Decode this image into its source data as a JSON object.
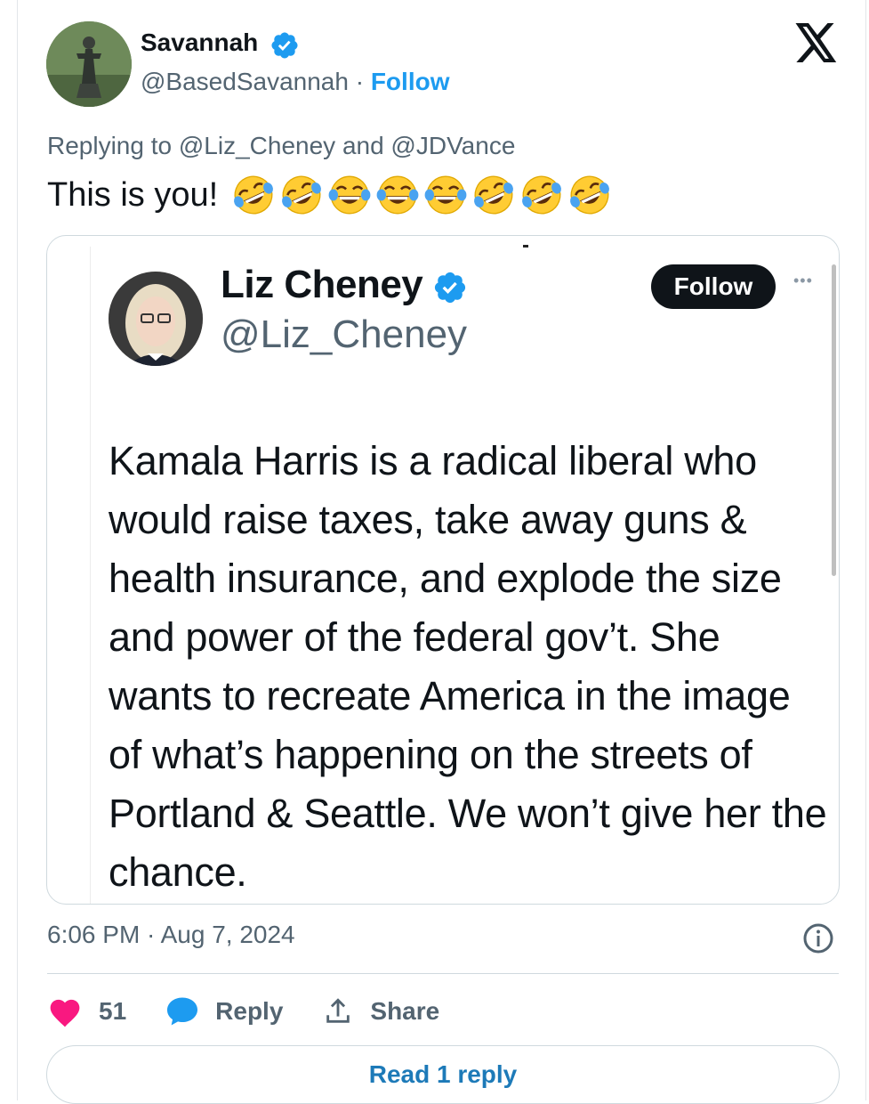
{
  "author": {
    "name": "Savannah",
    "handle": "@BasedSavannah",
    "separator": " · ",
    "follow_label": "Follow"
  },
  "replying_to": "Replying to @Liz_Cheney and @JDVance",
  "tweet": {
    "text": "This is you!",
    "emojis": [
      "rolling-on-floor-laughing",
      "rolling-on-floor-laughing",
      "face-with-tears-of-joy",
      "face-with-tears-of-joy",
      "face-with-tears-of-joy",
      "rolling-on-floor-laughing",
      "rolling-on-floor-laughing",
      "rolling-on-floor-laughing"
    ]
  },
  "quoted": {
    "name": "Liz Cheney",
    "handle": "@Liz_Cheney",
    "follow_label": "Follow",
    "more_label": "•••",
    "body": "Kamala Harris is a radical liberal who would raise taxes, take away guns & health insurance, and explode the size and power of the federal gov’t. She wants to recreate America in the image of what’s happening on the streets of Portland & Seattle. We won’t give her the chance."
  },
  "timestamp": "6:06 PM · Aug 7, 2024",
  "actions": {
    "like_count": "51",
    "reply_label": "Reply",
    "share_label": "Share"
  },
  "read_replies_label": "Read 1 reply",
  "icons": {
    "verified": "verified-badge-icon",
    "x_logo": "x-logo-icon",
    "heart": "heart-icon",
    "reply": "speech-bubble-icon",
    "share": "upload-share-icon",
    "info": "info-icon"
  },
  "colors": {
    "accent": "#1d9bf0",
    "like": "#f91880",
    "muted": "#536471",
    "border": "#cfd9de"
  }
}
